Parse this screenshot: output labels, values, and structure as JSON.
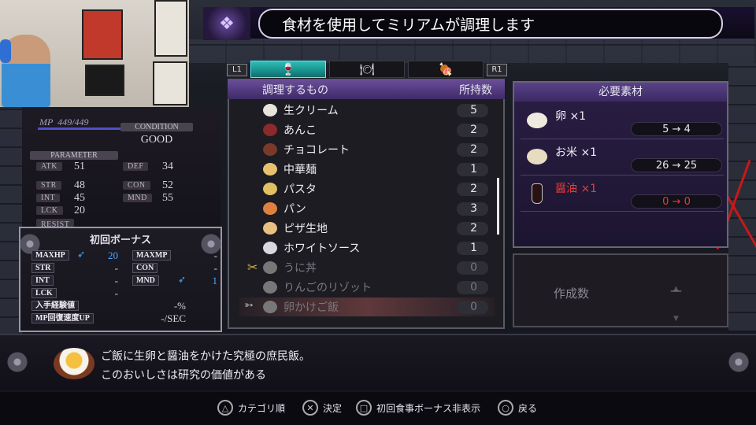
{
  "title_bar": {
    "text": "食材を使用してミリアムが調理します",
    "emblem": "skull-emblem-icon"
  },
  "category_tabs": {
    "left_button": "L1",
    "right_button": "R1",
    "tabs": [
      {
        "icon": "chef-hat-icon",
        "active": true
      },
      {
        "icon": "dish-icon",
        "active": false
      },
      {
        "icon": "meat-icon",
        "active": false
      }
    ]
  },
  "list": {
    "header_name": "調理するもの",
    "header_qty": "所持数",
    "rows": [
      {
        "name": "生クリーム",
        "qty": "5",
        "icon": "cream-bowl-icon",
        "dim": false
      },
      {
        "name": "あんこ",
        "qty": "2",
        "icon": "bowl-icon",
        "dim": false
      },
      {
        "name": "チョコレート",
        "qty": "2",
        "icon": "chocolate-icon",
        "dim": false
      },
      {
        "name": "中華麺",
        "qty": "1",
        "icon": "noodles-icon",
        "dim": false
      },
      {
        "name": "パスタ",
        "qty": "2",
        "icon": "pasta-icon",
        "dim": false
      },
      {
        "name": "パン",
        "qty": "3",
        "icon": "bread-icon",
        "dim": false
      },
      {
        "name": "ピザ生地",
        "qty": "2",
        "icon": "pizza-dough-icon",
        "dim": false
      },
      {
        "name": "ホワイトソース",
        "qty": "1",
        "icon": "sauce-pot-icon",
        "dim": false
      },
      {
        "name": "うに丼",
        "qty": "0",
        "icon": "bowl-icon",
        "dim": true
      },
      {
        "name": "りんごのリゾット",
        "qty": "0",
        "icon": "bowl-icon",
        "dim": true
      },
      {
        "name": "卵かけご飯",
        "qty": "0",
        "icon": "bowl-icon",
        "dim": true
      }
    ]
  },
  "required": {
    "header": "必要素材",
    "materials": [
      {
        "name": "卵 ×1",
        "count": "5 → 4",
        "icon": "eggs-icon",
        "red": false
      },
      {
        "name": "お米 ×1",
        "count": "26 → 25",
        "icon": "rice-icon",
        "red": false
      },
      {
        "name": "醤油 ×1",
        "count": "0 → 0",
        "icon": "soy-sauce-icon",
        "red": true
      }
    ]
  },
  "quantity": {
    "label": "作成数",
    "value": "—"
  },
  "description": {
    "line1": "ご飯に生卵と醤油をかけた究極の庶民飯。",
    "line2": "このおいしさは研究の価値がある",
    "icon": "egg-rice-bowl-icon"
  },
  "hints": [
    {
      "button": "triangle",
      "glyph": "△",
      "label": "カテゴリ順"
    },
    {
      "button": "cross",
      "glyph": "✕",
      "label": "決定"
    },
    {
      "button": "square",
      "glyph": "□",
      "label": "初回食事ボーナス非表示"
    },
    {
      "button": "circle",
      "glyph": "○",
      "label": "戻る"
    }
  ],
  "status": {
    "mp_label": "MP",
    "mp_value": "449/449",
    "condition_label": "CONDITION",
    "condition_value": "GOOD",
    "parameter_label": "PARAMETER",
    "resist_label": "RESIST",
    "stats": [
      {
        "label": "ATK",
        "value": "51"
      },
      {
        "label": "DEF",
        "value": "34"
      },
      {
        "label": "STR",
        "value": "48"
      },
      {
        "label": "CON",
        "value": "52"
      },
      {
        "label": "INT",
        "value": "45"
      },
      {
        "label": "MND",
        "value": "55"
      },
      {
        "label": "LCK",
        "value": "20"
      }
    ]
  },
  "bonus": {
    "title": "初回ボーナス",
    "rows": [
      {
        "label": "MAXHP",
        "value": "20",
        "up": true,
        "label2": "MAXMP",
        "value2": "-"
      },
      {
        "label": "STR",
        "value": "-",
        "up": false,
        "label2": "CON",
        "value2": "-"
      },
      {
        "label": "INT",
        "value": "-",
        "up": false,
        "label2": "MND",
        "value2": "1",
        "up2": true
      },
      {
        "label": "LCK",
        "value": "-"
      },
      {
        "label": "入手経験値",
        "value": "-%"
      },
      {
        "label": "MP回復速度UP",
        "value": "-/SEC"
      }
    ]
  }
}
